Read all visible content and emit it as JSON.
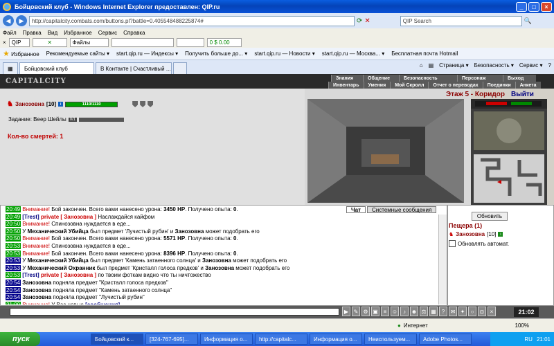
{
  "window": {
    "title": "Бойцовский клуб - Windows Internet Explorer предоставлен: QIP.ru",
    "min": "_",
    "max": "□",
    "close": "×"
  },
  "address": {
    "url": "http://capitalcity.combats.com/buttons.pl?battle=0.405548488225874#",
    "search_placeholder": "QIP Search"
  },
  "menu": [
    "Файл",
    "Правка",
    "Вид",
    "Избранное",
    "Сервис",
    "Справка"
  ],
  "toolbar": {
    "files_label": "Файлы",
    "qip_value": "0 $ 0.00"
  },
  "favorites": {
    "label": "Избранное",
    "items": [
      "Рекомендуемые сайты ▾",
      "start.qip.ru — Индексы ▾",
      "Получить больше до... ▾",
      "start.qip.ru — Новости ▾",
      "start.qip.ru — Москва... ▾",
      "Бесплатная почта Hotmail"
    ]
  },
  "tabs": [
    {
      "label": "Бойцовский клуб",
      "active": true
    },
    {
      "label": "В Контакте | Счастливый ...",
      "active": false
    }
  ],
  "tab_tools": [
    "Страница ▾",
    "Безопасность ▾",
    "Сервис ▾"
  ],
  "game": {
    "logo": "CAPITALCITY",
    "menu_top": [
      "Знания",
      "Общение",
      "Безопасность",
      "Персонаж",
      "Выход"
    ],
    "menu_bottom": [
      "Инвентарь",
      "Умения",
      "Мой Скролл",
      "Отчет о переводах",
      "Поединки",
      "Анкета"
    ],
    "player": {
      "name": "Занозовна",
      "level": "[10]",
      "hp": "1110/1110"
    },
    "task": {
      "label": "Задание: Веер Шейлы",
      "progress_text": "0/1"
    },
    "deaths": "Кол-во смертей: 1",
    "location": "Этаж 5 - Коридор",
    "exit": "Выйти"
  },
  "chat": {
    "tabs": [
      {
        "label": "Чат",
        "active": true
      },
      {
        "label": "Системные сообщения",
        "active": false
      }
    ],
    "lines": [
      {
        "t": "20:49",
        "parts": [
          {
            "c": "warn",
            "x": "Внимание!"
          },
          {
            "c": "",
            "x": " Бой закончен. Всего вами нанесено урона: "
          },
          {
            "c": "bold",
            "x": "3450 HP"
          },
          {
            "c": "",
            "x": ". Получено опыта: "
          },
          {
            "c": "bold",
            "x": "0"
          },
          {
            "c": "",
            "x": "."
          }
        ]
      },
      {
        "t": "20:49",
        "parts": [
          {
            "c": "trest",
            "x": "[Trest] "
          },
          {
            "c": "priv",
            "x": "private [ Занозовна ]"
          },
          {
            "c": "",
            "x": " Наслаждайся кайфом"
          }
        ]
      },
      {
        "t": "20:50",
        "parts": [
          {
            "c": "warn",
            "x": "Внимание!"
          },
          {
            "c": "",
            "x": " Спинозовна нуждается в еде..."
          }
        ]
      },
      {
        "t": "20:50",
        "parts": [
          {
            "c": "",
            "x": "У "
          },
          {
            "c": "bold",
            "x": "Механический Убийца"
          },
          {
            "c": "",
            "x": " был предмет 'Лучистый рубин' и "
          },
          {
            "c": "bold",
            "x": "Занозовна"
          },
          {
            "c": "",
            "x": " может подобрать его"
          }
        ]
      },
      {
        "t": "20:50",
        "parts": [
          {
            "c": "warn",
            "x": "Внимание!"
          },
          {
            "c": "",
            "x": " Бой закончен. Всего вами нанесено урона: "
          },
          {
            "c": "bold",
            "x": "5571 HP"
          },
          {
            "c": "",
            "x": ". Получено опыта: "
          },
          {
            "c": "bold",
            "x": "0"
          },
          {
            "c": "",
            "x": "."
          }
        ]
      },
      {
        "t": "20:53",
        "parts": [
          {
            "c": "warn",
            "x": "Внимание!"
          },
          {
            "c": "",
            "x": " Спинозовна нуждается в еде..."
          }
        ]
      },
      {
        "t": "20:53",
        "parts": [
          {
            "c": "warn",
            "x": "Внимание!"
          },
          {
            "c": "",
            "x": " Бой закончен. Всего вами нанесено урона: "
          },
          {
            "c": "bold",
            "x": "8396 HP"
          },
          {
            "c": "",
            "x": ". Получено опыта: "
          },
          {
            "c": "bold",
            "x": "0"
          },
          {
            "c": "",
            "x": "."
          }
        ]
      },
      {
        "t": "20:53",
        "blue": true,
        "parts": [
          {
            "c": "",
            "x": "У "
          },
          {
            "c": "bold",
            "x": "Механический Убийца"
          },
          {
            "c": "",
            "x": " был предмет 'Камень затаенного солнца' и "
          },
          {
            "c": "bold",
            "x": "Занозовна"
          },
          {
            "c": "",
            "x": " может подобрать его"
          }
        ]
      },
      {
        "t": "20:53",
        "blue": true,
        "parts": [
          {
            "c": "",
            "x": "У "
          },
          {
            "c": "bold",
            "x": "Механический Охранник"
          },
          {
            "c": "",
            "x": " был предмет 'Кристалл голоса предков' и "
          },
          {
            "c": "bold",
            "x": "Занозовна"
          },
          {
            "c": "",
            "x": " может подобрать его"
          }
        ]
      },
      {
        "t": "20:53",
        "parts": [
          {
            "c": "trest",
            "x": "[Trest] "
          },
          {
            "c": "priv",
            "x": "private [ Занозовна ]"
          },
          {
            "c": "",
            "x": " по твоим фоткам видно что ты ничтожество"
          }
        ]
      },
      {
        "t": "20:54",
        "blue": true,
        "parts": [
          {
            "c": "bold",
            "x": "Занозовна"
          },
          {
            "c": "",
            "x": " подняла предмет \"Кристалл голоса предков\""
          }
        ]
      },
      {
        "t": "20:54",
        "blue": true,
        "parts": [
          {
            "c": "bold",
            "x": "Занозовна"
          },
          {
            "c": "",
            "x": " подняла предмет \"Камень затаенного солнца\""
          }
        ]
      },
      {
        "t": "20:54",
        "blue": true,
        "parts": [
          {
            "c": "bold",
            "x": "Занозовна"
          },
          {
            "c": "",
            "x": " подняла предмет \"Лучистый рубин\""
          }
        ]
      },
      {
        "t": "21:00",
        "parts": [
          {
            "c": "warn",
            "x": "Внимание!"
          },
          {
            "c": "",
            "x": " У Вас новые "
          },
          {
            "c": "trest",
            "x": "[сообщения]"
          }
        ]
      }
    ]
  },
  "room": {
    "refresh": "Обновить",
    "title": "Пещера (1)",
    "player": "Занозовна",
    "player_level": "[10]",
    "auto": "Обновлять автомат."
  },
  "bottom": {
    "clock": "21:02"
  },
  "status": {
    "zone": "Интернет",
    "zoom": "100%"
  },
  "taskbar": {
    "start": "пуск",
    "items": [
      "Бойцовский к...",
      "[324-767-695]...",
      "Информация о...",
      "http://capitalc...",
      "Информация о...",
      "Неиспользуем...",
      "Adobe Photos..."
    ],
    "lang": "RU",
    "time": "21:01"
  }
}
